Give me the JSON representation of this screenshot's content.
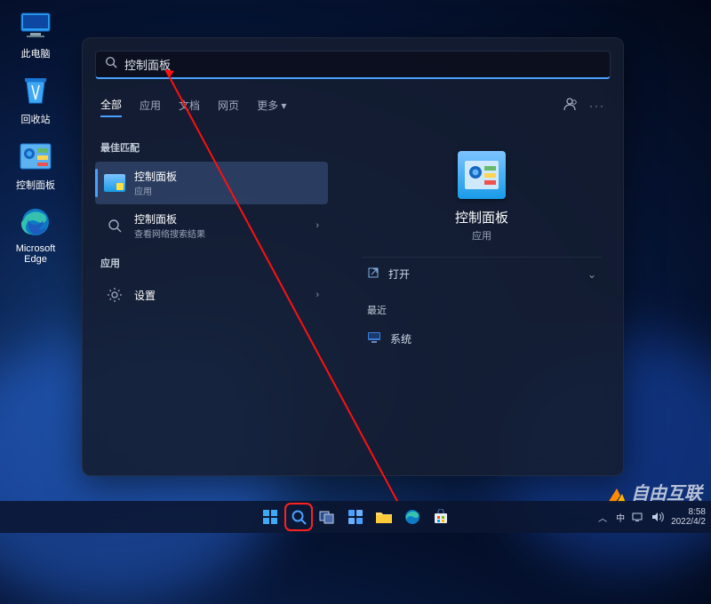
{
  "desktop": {
    "icons": [
      {
        "label": "此电脑"
      },
      {
        "label": "回收站"
      },
      {
        "label": "控制面板"
      },
      {
        "label": "Microsoft Edge"
      }
    ]
  },
  "search": {
    "query": "控制面板",
    "tabs": {
      "all": "全部",
      "apps": "应用",
      "docs": "文档",
      "web": "网页",
      "more": "更多"
    },
    "sections": {
      "best_match": "最佳匹配",
      "apps": "应用"
    },
    "results": {
      "best": {
        "title": "控制面板",
        "subtitle": "应用"
      },
      "search_web": {
        "title": "控制面板",
        "subtitle": "查看网络搜索结果"
      },
      "settings": {
        "title": "设置"
      }
    },
    "detail": {
      "title": "控制面板",
      "subtitle": "应用",
      "open_label": "打开",
      "recent_label": "最近",
      "recent_item": "系统"
    }
  },
  "taskbar": {
    "time": "8:58",
    "date": "2022/4/2",
    "ime": "中"
  },
  "watermark": "自由互联"
}
